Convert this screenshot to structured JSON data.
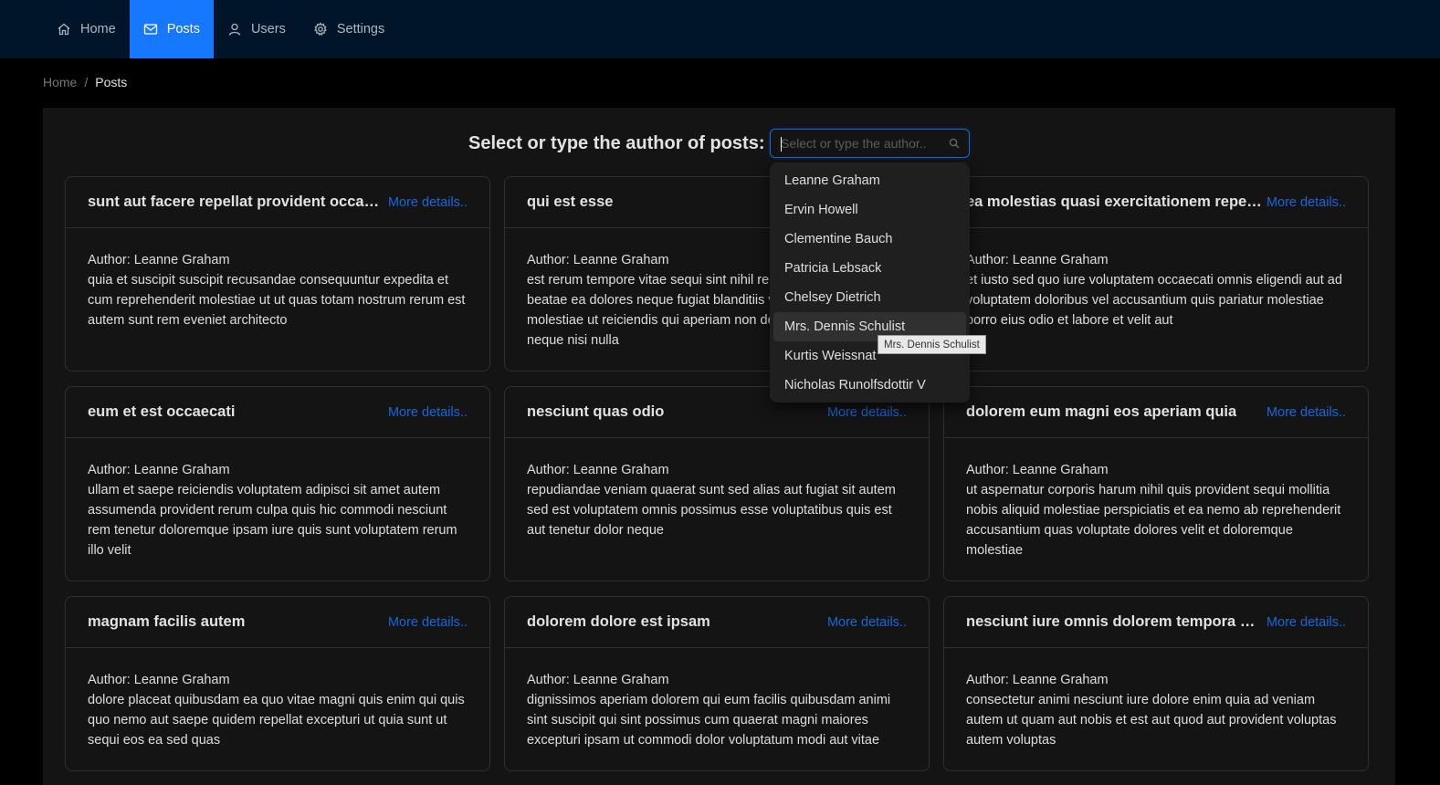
{
  "nav": {
    "items": [
      {
        "label": "Home",
        "icon": "home-icon"
      },
      {
        "label": "Posts",
        "icon": "mail-icon"
      },
      {
        "label": "Users",
        "icon": "user-icon"
      },
      {
        "label": "Settings",
        "icon": "gear-icon"
      }
    ],
    "active": "Posts",
    "background": "#001529",
    "active_color": "#1677ff"
  },
  "breadcrumb": {
    "home": "Home",
    "separator": "/",
    "current": "Posts"
  },
  "selector": {
    "label": "Select or type the author of posts:",
    "placeholder": "Select or type the author..",
    "icon": "search-icon"
  },
  "dropdown": {
    "options": [
      "Leanne Graham",
      "Ervin Howell",
      "Clementine Bauch",
      "Patricia Lebsack",
      "Chelsey Dietrich",
      "Mrs. Dennis Schulist",
      "Kurtis Weissnat",
      "Nicholas Runolfsdottir V"
    ],
    "hovered": "Mrs. Dennis Schulist"
  },
  "tooltip": "Mrs. Dennis Schulist",
  "more_label": "More details..",
  "posts": [
    {
      "title": "sunt aut facere repellat provident occaecati excepturi optio reprehenderit",
      "author": "Author: Leanne Graham",
      "body": "quia et suscipit suscipit recusandae consequuntur expedita et cum reprehenderit molestiae ut ut quas totam nostrum rerum est autem sunt rem eveniet architecto"
    },
    {
      "title": "qui est esse",
      "author": "Author: Leanne Graham",
      "body": "est rerum tempore vitae sequi sint nihil reprehenderit dolor beatae ea dolores neque fugiat blanditiis voluptate porro vel nihil molestiae ut reiciendis qui aperiam non debitis possimus qui neque nisi nulla"
    },
    {
      "title": "ea molestias quasi exercitationem repellat qui ipsa sit aut",
      "author": "Author: Leanne Graham",
      "body": "et iusto sed quo iure voluptatem occaecati omnis eligendi aut ad voluptatem doloribus vel accusantium quis pariatur molestiae porro eius odio et labore et velit aut"
    },
    {
      "title": "eum et est occaecati",
      "author": "Author: Leanne Graham",
      "body": "ullam et saepe reiciendis voluptatem adipisci sit amet autem assumenda provident rerum culpa quis hic commodi nesciunt rem tenetur doloremque ipsam iure quis sunt voluptatem rerum illo velit"
    },
    {
      "title": "nesciunt quas odio",
      "author": "Author: Leanne Graham",
      "body": "repudiandae veniam quaerat sunt sed alias aut fugiat sit autem sed est voluptatem omnis possimus esse voluptatibus quis est aut tenetur dolor neque"
    },
    {
      "title": "dolorem eum magni eos aperiam quia",
      "author": "Author: Leanne Graham",
      "body": "ut aspernatur corporis harum nihil quis provident sequi mollitia nobis aliquid molestiae perspiciatis et ea nemo ab reprehenderit accusantium quas voluptate dolores velit et doloremque molestiae"
    },
    {
      "title": "magnam facilis autem",
      "author": "Author: Leanne Graham",
      "body": "dolore placeat quibusdam ea quo vitae magni quis enim qui quis quo nemo aut saepe quidem repellat excepturi ut quia sunt ut sequi eos ea sed quas"
    },
    {
      "title": "dolorem dolore est ipsam",
      "author": "Author: Leanne Graham",
      "body": "dignissimos aperiam dolorem qui eum facilis quibusdam animi sint suscipit qui sint possimus cum quaerat magni maiores excepturi ipsam ut commodi dolor voluptatum modi aut vitae"
    },
    {
      "title": "nesciunt iure omnis dolorem tempora et accusantium",
      "author": "Author: Leanne Graham",
      "body": "consectetur animi nesciunt iure dolore enim quia ad veniam autem ut quam aut nobis et est aut quod aut provident voluptas autem voluptas"
    }
  ]
}
